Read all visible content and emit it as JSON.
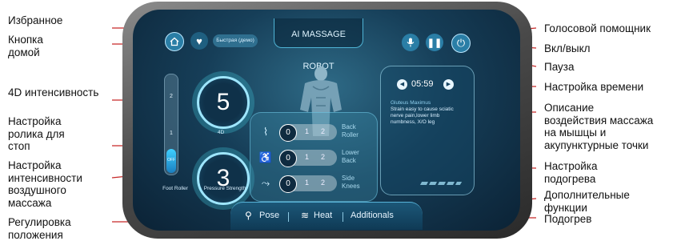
{
  "screen": {
    "title": "AI MASSAGE ROBOT",
    "mode_pill": "Быстрая (демо)",
    "time": "05:59",
    "intensity_4d": {
      "value": "5",
      "caption": "4D"
    },
    "air_pressure": {
      "value": "3",
      "caption": "Pressure Strength"
    },
    "foot_roller": {
      "caption": "Foot Roller",
      "labels": [
        "2",
        "1",
        "OFF"
      ],
      "level_fraction": 0.25
    },
    "heat_rows": [
      {
        "knob": "0",
        "n1": "1",
        "n2": "2",
        "label": "Back Roller"
      },
      {
        "knob": "0",
        "n1": "1",
        "n2": "2",
        "label": "Lower Back"
      },
      {
        "knob": "0",
        "n1": "1",
        "n2": "2",
        "label": "Side Knees"
      }
    ],
    "description": {
      "title": "Gluteus Maximus",
      "text": "Strain easy to cause sciatic nerve pain,lower limb numbness, X/O leg"
    },
    "bottom_bar": {
      "pose": "Pose",
      "heat": "Heat",
      "additionals": "Additionals"
    }
  },
  "callouts": {
    "favorites": "Избранное",
    "home_button": "Кнопка\nдомой",
    "intensity_4d": "4D интенсивность",
    "foot_roller": "Настройка\nролика для\nстоп",
    "air_intensity": "Настройка\nинтенсивности\nвоздушного\nмассажа",
    "position": "Регулировка\nположения",
    "voice": "Голосовой помощник",
    "power": "Вкл/выкл",
    "pause": "Пауза",
    "time_setting": "Настройка времени",
    "description": "Описание\nвоздействия массажа\nна мышцы и\nакупунктурные точки",
    "heat_setting": "Настройка\nподогрева",
    "additional": "Дополнительные\nфункции",
    "heating": "Подогрев"
  },
  "colors": {
    "screen_bg": "#163e58",
    "accent": "#9ee6ff",
    "callout_line": "#c62828"
  },
  "icons": [
    "home-icon",
    "heart-icon",
    "microphone-icon",
    "pause-icon",
    "power-icon",
    "left-arrow-icon",
    "right-arrow-icon",
    "massage-chair-icon",
    "heat-waves-icon"
  ]
}
